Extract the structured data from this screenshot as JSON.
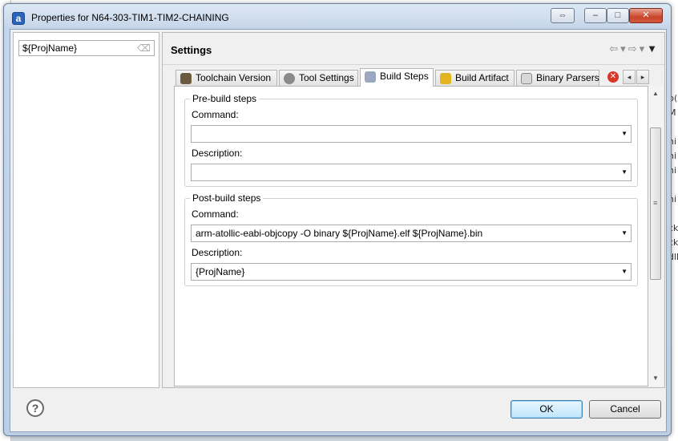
{
  "window": {
    "title": "Properties for N64-303-TIM1-TIM2-CHAINING",
    "icon_letter": "a",
    "controls": {
      "restore": "⇔",
      "minimize": "–",
      "maximize": "□",
      "close": "✕"
    }
  },
  "left_pane": {
    "filter": {
      "value": "${ProjName}",
      "clear_icon": "eraser-icon"
    }
  },
  "settings": {
    "title": "Settings",
    "nav": {
      "back": "⇦",
      "back_menu": "▾",
      "forward": "⇨",
      "forward_menu": "▾",
      "view_menu": "▼"
    }
  },
  "tabs": [
    {
      "label": "Toolchain Version",
      "icon": "toolchain-icon"
    },
    {
      "label": "Tool Settings",
      "icon": "gear-icon"
    },
    {
      "label": "Build Steps",
      "icon": "wand-icon",
      "active": true
    },
    {
      "label": "Build Artifact",
      "icon": "trophy-icon"
    },
    {
      "label": "Binary Parsers",
      "icon": "binary-icon"
    }
  ],
  "tab_controls": {
    "close": "✕",
    "left": "◂",
    "right": "▸"
  },
  "pre_build": {
    "legend": "Pre-build steps",
    "command_label": "Command:",
    "command_value": "",
    "description_label": "Description:",
    "description_value": ""
  },
  "post_build": {
    "legend": "Post-build steps",
    "command_label": "Command:",
    "command_value": "arm-atollic-eabi-objcopy -O binary ${ProjName}.elf  ${ProjName}.bin",
    "description_label": "Description:",
    "description_value": "{ProjName}"
  },
  "combo_arrow": "▼",
  "scrollbar": {
    "up": "▲",
    "down": "▼",
    "grip": "≡"
  },
  "buttons": {
    "help": "?",
    "ok": "OK",
    "cancel": "Cancel"
  },
  "background_text": [
    "ni",
    "ni",
    "ni",
    "ni",
    "ck",
    "ck",
    "dll",
    "M",
    "b("
  ],
  "colors": {
    "accent": "#2a64b8",
    "close_red": "#c8452a",
    "default_button": "#3c7fb1"
  }
}
